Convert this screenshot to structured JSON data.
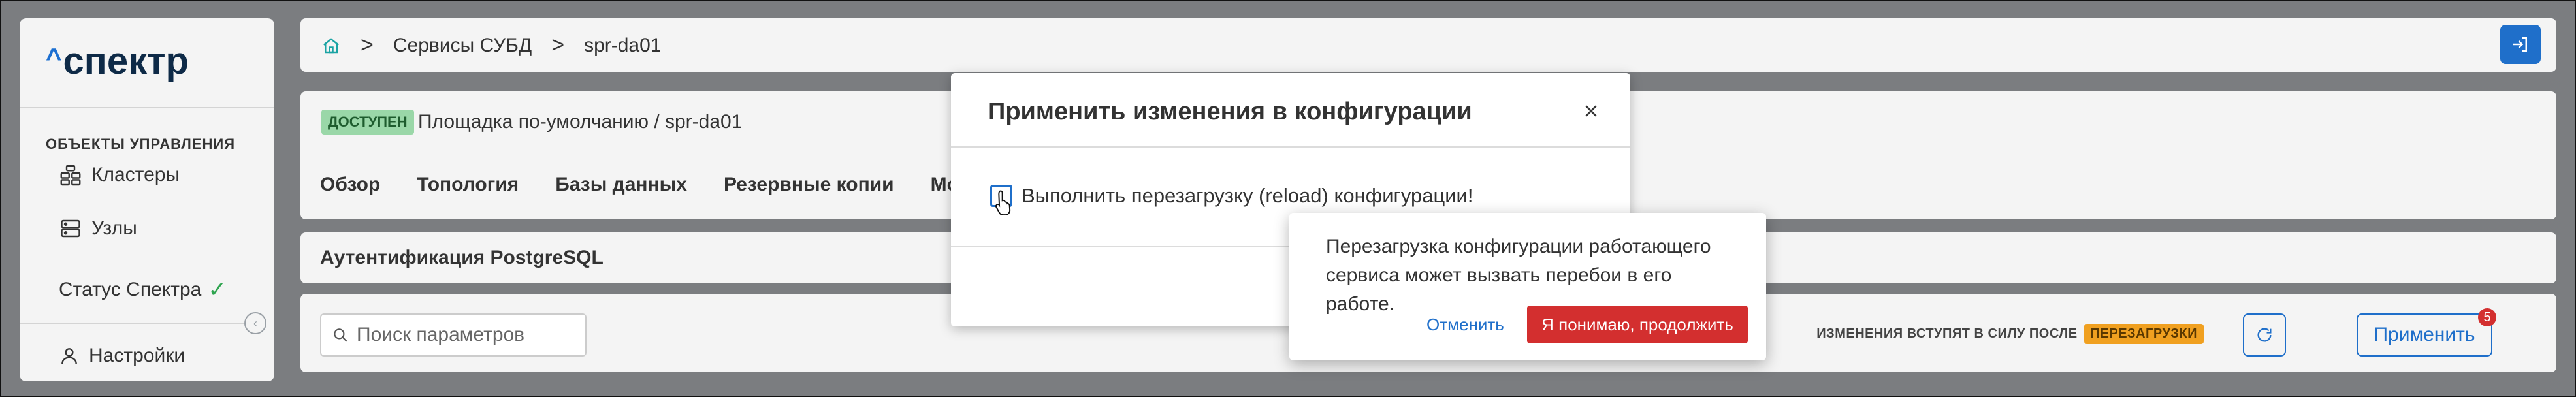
{
  "sidebar": {
    "logo_caret": "^",
    "logo_text": "спектр",
    "section_caption": "ОБЪЕКТЫ УПРАВЛЕНИЯ",
    "items": [
      {
        "label": "Кластеры",
        "icon": "clusters-icon"
      },
      {
        "label": "Узлы",
        "icon": "nodes-icon"
      }
    ],
    "status_label": "Статус Спектра",
    "settings_label": "Настройки"
  },
  "breadcrumbs": {
    "home_icon": "home-icon",
    "items": [
      "Сервисы СУБД",
      "spr-da01"
    ],
    "separator": ">"
  },
  "service": {
    "status_badge": "ДОСТУПЕН",
    "site_line": "Площадка по-умолчанию / spr-da01"
  },
  "tabs": [
    "Обзор",
    "Топология",
    "Базы данных",
    "Резервные копии",
    "Монито"
  ],
  "section_title": "Аутентификация PostgreSQL",
  "search": {
    "placeholder": "Поиск параметров"
  },
  "restart_note": {
    "text": "ИЗМЕНЕНИЯ ВСТУПЯТ В СИЛУ ПОСЛЕ",
    "badge": "ПЕРЕЗАГРУЗКИ"
  },
  "apply": {
    "label": "Применить",
    "count": "5"
  },
  "modal": {
    "title": "Применить изменения в конфигурации",
    "checkbox_label": "Выполнить перезагрузку (reload) конфигурации!"
  },
  "popover": {
    "text": "Перезагрузка конфигурации работающего сервиса может вызвать перебои в его работе.",
    "cancel_label": "Отменить",
    "confirm_label": "Я понимаю, продолжить"
  },
  "colors": {
    "accent": "#1f6fca",
    "danger": "#d32f2f",
    "success_badge": "#9ad7a8",
    "warning_badge": "#f0a020"
  }
}
